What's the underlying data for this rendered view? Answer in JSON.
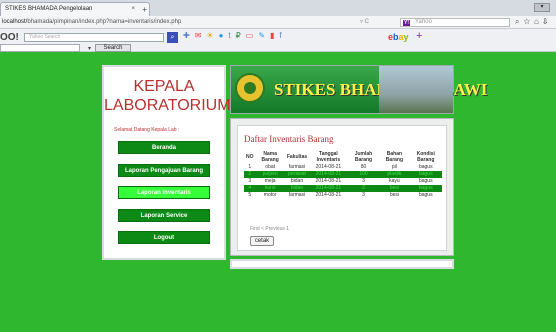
{
  "browser": {
    "tab_title": "STIKES BHAMADA Pengelolaan",
    "tab_close": "×",
    "tab_new": "+",
    "url_prefix": "localhost/",
    "url_rest": "bhamada/pimpinan/index.php?nama=inventaris/index.php",
    "search_placeholder": "Yahoo",
    "yahoo_logo": "OO!",
    "yahoo_search_placeholder": "Yahoo Search",
    "search_button": "Search",
    "ebay": [
      "e",
      "b",
      "a",
      "y"
    ]
  },
  "sidebar": {
    "title": "KEPALA LABORATORIUM",
    "welcome": "Selamat Datang Kepala Lab :",
    "menu": [
      {
        "label": "Beranda",
        "active": false
      },
      {
        "label": "Laporan Pengajuan Barang",
        "active": false
      },
      {
        "label": "Laporan Inventaris",
        "active": true
      },
      {
        "label": "Laporan Service",
        "active": false
      },
      {
        "label": "Logout",
        "active": false
      }
    ]
  },
  "banner": {
    "title": "STIKES BHAMADA SLAWI"
  },
  "main": {
    "heading": "Daftar Inventaris Barang",
    "columns": [
      "NO",
      "Nama Barang",
      "Fakultas",
      "Tanggal Inventaris",
      "Jumlah Barang",
      "Bahan Barang",
      "Kondisi Barang"
    ],
    "rows": [
      [
        "1",
        "obat",
        "farmasi",
        "2014-08-21",
        "80",
        "pil",
        "bagus"
      ],
      [
        "2",
        "pulpen",
        "perawat",
        "2014-08-21",
        "100",
        "plastik",
        "bagus"
      ],
      [
        "3",
        "meja",
        "bidan",
        "2014-08-21",
        "3",
        "kayu",
        "bagus"
      ],
      [
        "4",
        "kursi",
        "bidan",
        "2014-08-21",
        "2",
        "besi",
        "bagus"
      ],
      [
        "5",
        "motor",
        "farmasi",
        "2014-08-21",
        "3",
        "besi",
        "bagus"
      ]
    ],
    "pager": "First < Previous 1",
    "print_button": "cetak"
  }
}
